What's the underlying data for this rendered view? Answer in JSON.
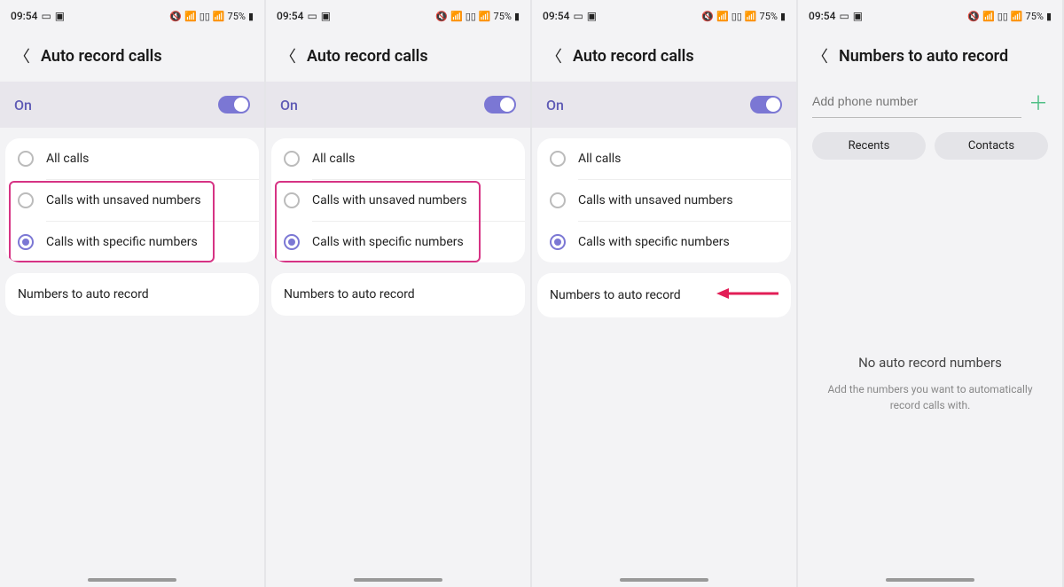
{
  "status": {
    "time": "09:54",
    "battery": "75%"
  },
  "auto_record": {
    "header": "Auto record calls",
    "on_label": "On",
    "options": {
      "all": "All calls",
      "unsaved": "Calls with unsaved numbers",
      "specific": "Calls with specific numbers"
    },
    "numbers_link": "Numbers to auto record"
  },
  "numbers_screen": {
    "header": "Numbers to auto record",
    "placeholder": "Add phone number",
    "recents": "Recents",
    "contacts": "Contacts",
    "empty_title": "No auto record numbers",
    "empty_sub": "Add the numbers you want to automatically record calls with."
  }
}
